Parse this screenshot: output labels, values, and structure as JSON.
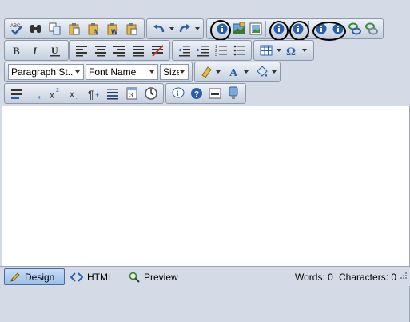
{
  "toolbar": {
    "row1_icons": [
      "spellcheck-icon",
      "find-icon",
      "copy-icon",
      "paste-icon",
      "paste-text-icon",
      "paste-word-icon",
      "paste-html-icon"
    ],
    "row3": {
      "paragraph_style": "Paragraph St...",
      "font_name": "Font Name",
      "size": "Size"
    }
  },
  "status": {
    "design_label": "Design",
    "html_label": "HTML",
    "preview_label": "Preview",
    "words_label": "Words: 0",
    "characters_label": "Characters: 0",
    "active_mode": "Design"
  },
  "colors": {
    "toolbar_bg": "#d4dbe6",
    "button_group_gradient_top": "#eef2f8",
    "button_group_gradient_bottom": "#c5cfde",
    "active_tab": "#9bbfe8",
    "content_bg": "#ffffff",
    "info_icon": "#2a5fa8"
  }
}
